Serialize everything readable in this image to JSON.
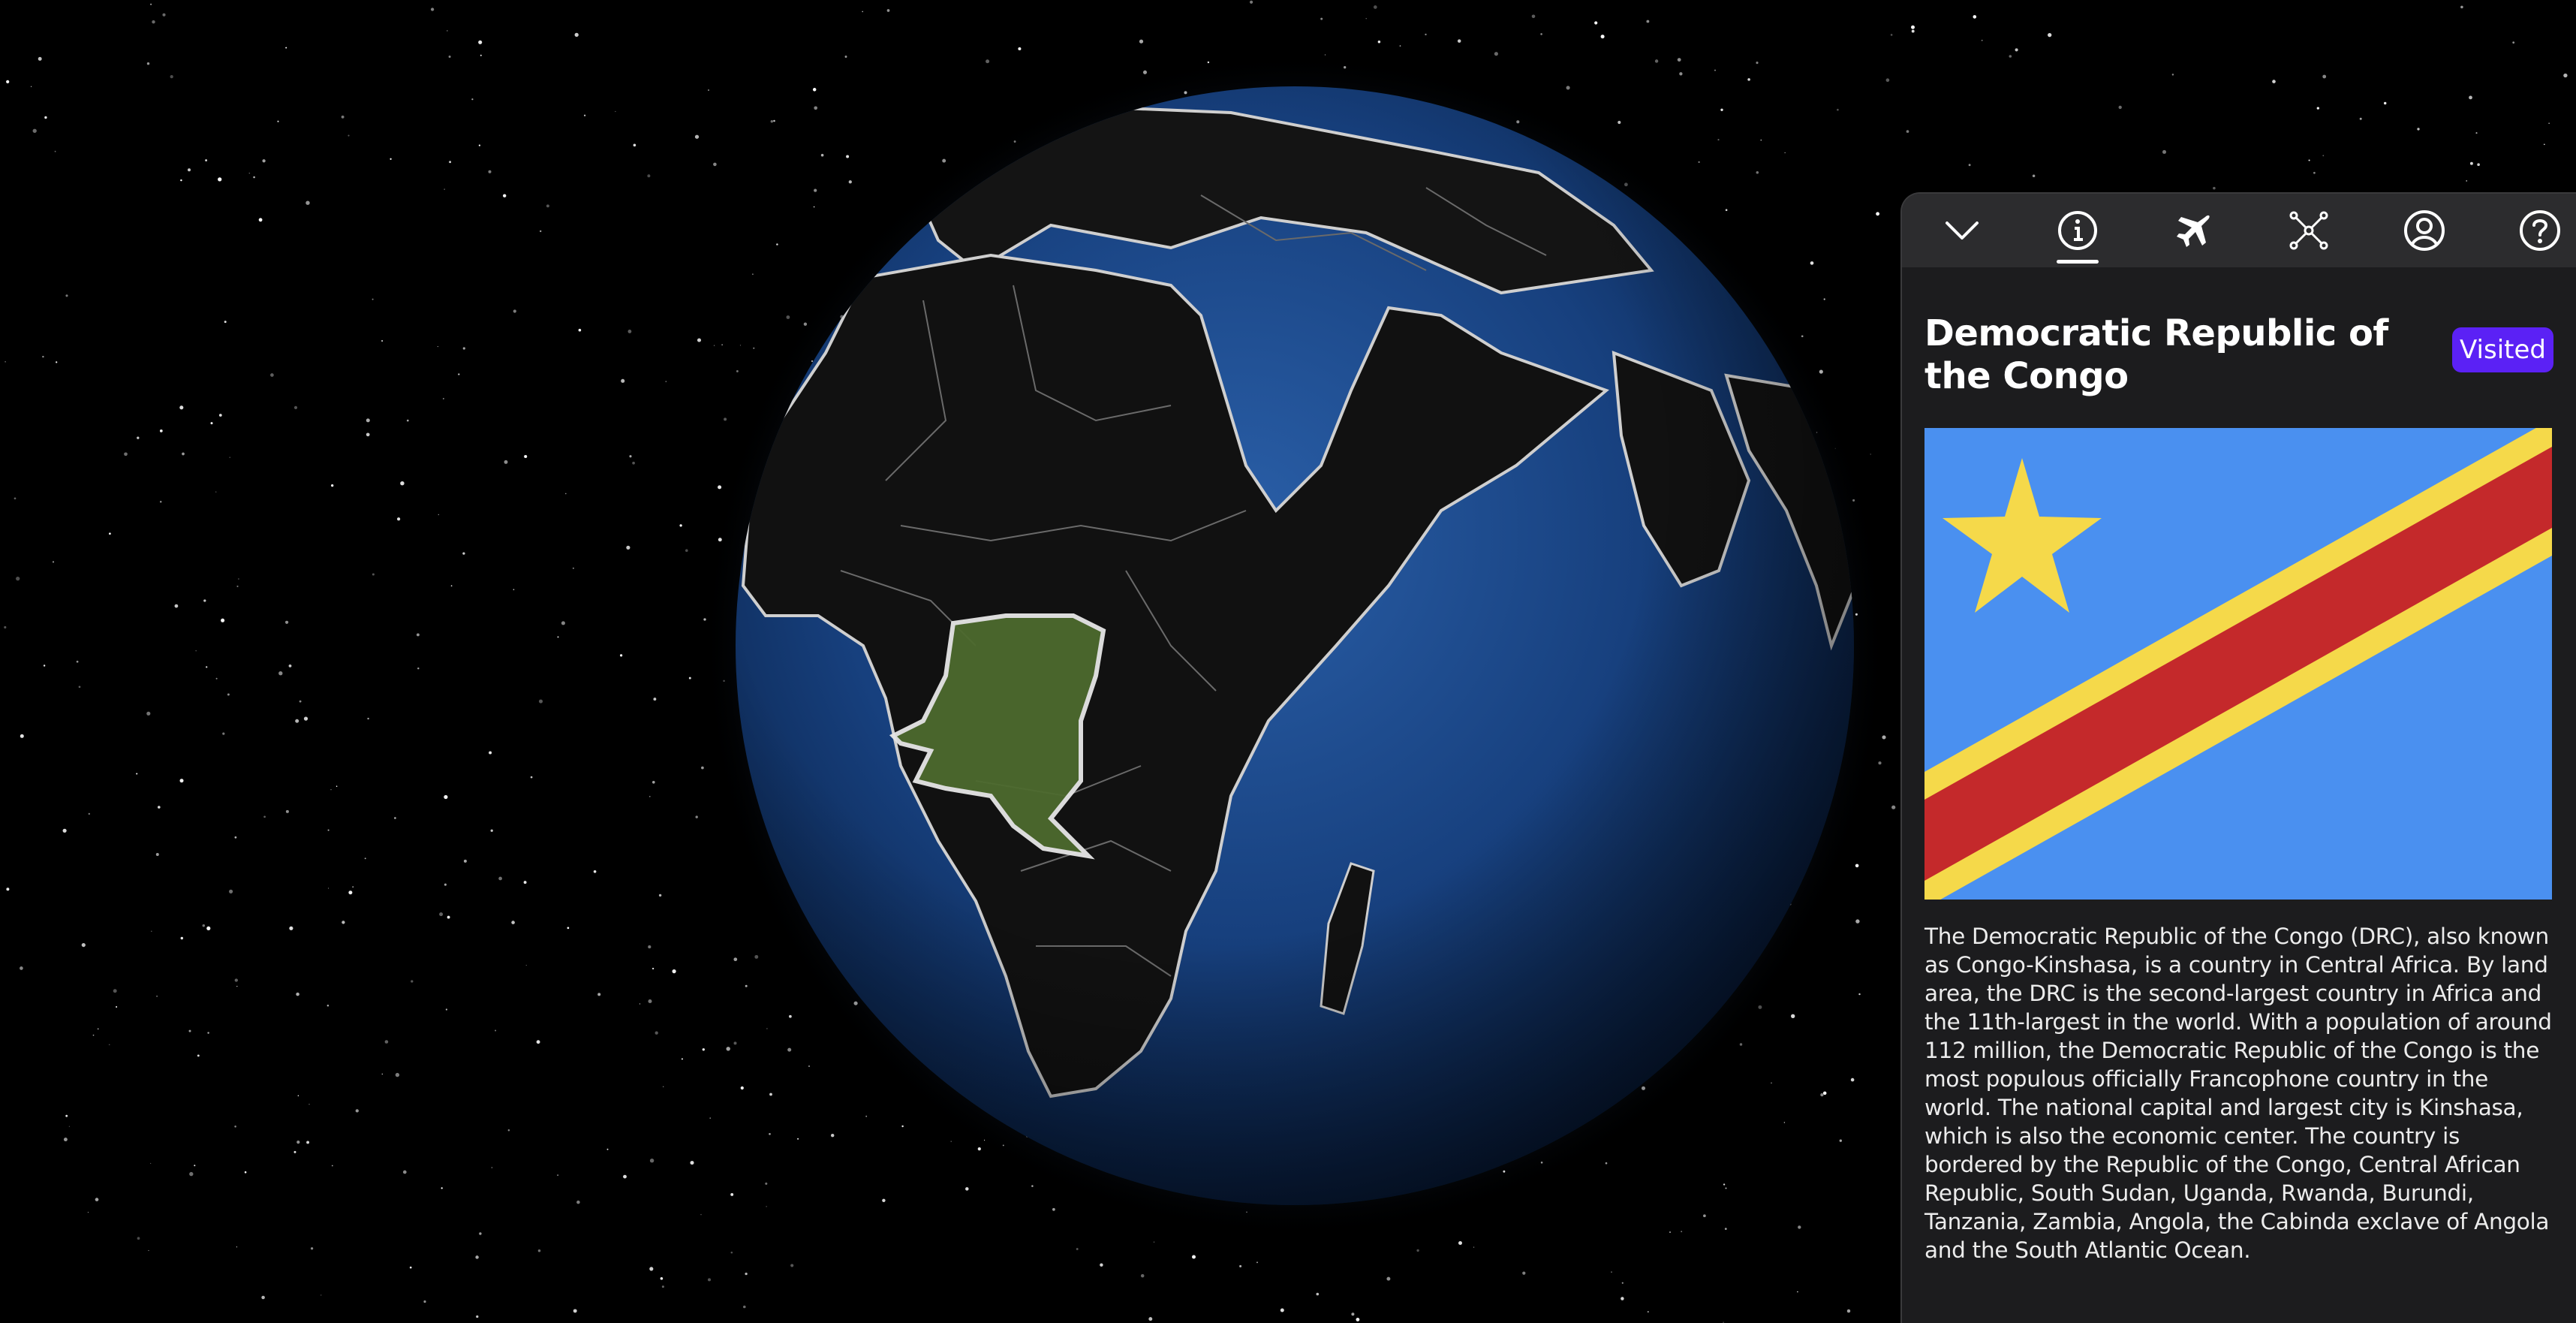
{
  "toolbar": {
    "items": [
      {
        "icon": "chevron-down-icon"
      },
      {
        "icon": "info-icon"
      },
      {
        "icon": "airplane-icon"
      },
      {
        "icon": "network-icon"
      },
      {
        "icon": "user-icon"
      },
      {
        "icon": "help-icon"
      }
    ],
    "active_tab": "info"
  },
  "country": {
    "name": "Democratic Republic of the Congo",
    "badge": "Visited",
    "description": "The Democratic Republic of the Congo (DRC), also known as Congo-Kinshasa, is a country in Central Africa. By land area, the DRC is the second-largest country in Africa and the 11th-largest in the world. With a population of around 112 million, the Democratic Republic of the Congo is the most populous officially Francophone country in the world. The national capital and largest city is Kinshasa, which is also the economic center. The country is bordered by the Republic of the Congo, Central African Republic, South Sudan, Uganda, Rwanda, Burundi, Tanzania, Zambia, Angola, the Cabinda exclave of Angola and the South Atlantic Ocean."
  },
  "colors": {
    "badge": "#5b21f5",
    "flag_blue": "#4a90f0",
    "flag_yellow": "#f5d94a",
    "flag_red": "#c4292b",
    "highlight_country": "#4d6a2e",
    "ocean": "#163a73"
  }
}
